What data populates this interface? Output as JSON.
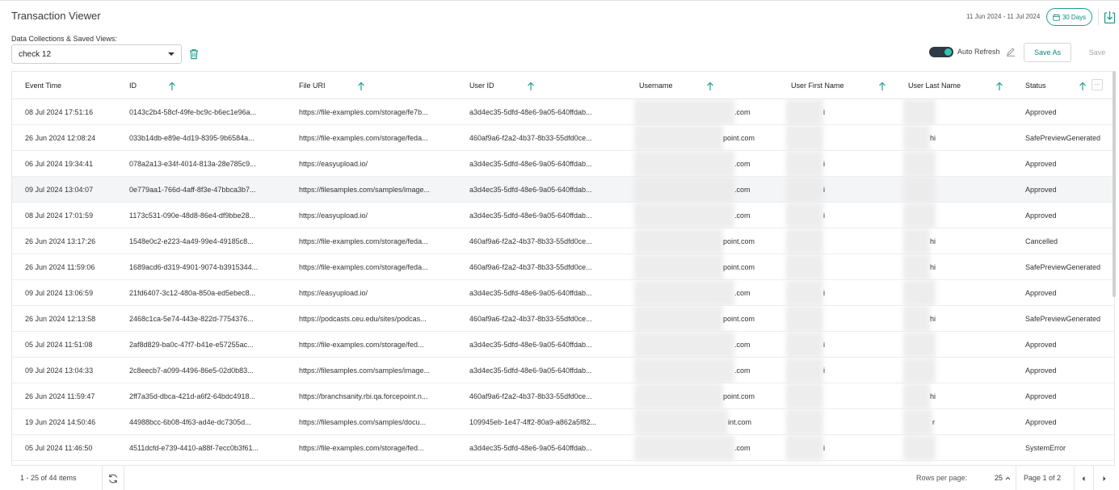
{
  "header": {
    "title": "Transaction Viewer",
    "date_range": "11 Jun 2024 - 11 Jul 2024",
    "days_label": "30 Days",
    "accent_color": "#1aa08e"
  },
  "collections": {
    "label": "Data Collections & Saved Views:",
    "selected": "check 12"
  },
  "toolbar": {
    "auto_refresh_label": "Auto Refresh",
    "auto_refresh_on": true,
    "save_as_label": "Save As",
    "save_label": "Save"
  },
  "table": {
    "columns": [
      "Event Time",
      "ID",
      "File URI",
      "User ID",
      "Username",
      "User First Name",
      "User Last Name",
      "Status"
    ],
    "rows": [
      {
        "time": "08 Jul 2024 17:51:16",
        "id": "0143c2b4-58cf-49fe-bc9c-b6ec1e96a...",
        "uri": "https://file-examples.com/storage/fe7b...",
        "user_id": "a3d4ec35-5dfd-48e6-9a05-640ffdab...",
        "username": ".com",
        "first": "i",
        "last": "",
        "status": "Approved"
      },
      {
        "time": "26 Jun 2024 12:08:24",
        "id": "033b14db-e89e-4d19-8395-9b6584a...",
        "uri": "https://file-examples.com/storage/feda...",
        "user_id": "460af9a6-f2a2-4b37-8b33-55dfd0ce...",
        "username": "point.com",
        "first": "",
        "last": "hi",
        "status": "SafePreviewGenerated"
      },
      {
        "time": "06 Jul 2024 19:34:41",
        "id": "078a2a13-e34f-4014-813a-28e785c9...",
        "uri": "https://easyupload.io/",
        "user_id": "a3d4ec35-5dfd-48e6-9a05-640ffdab...",
        "username": ".com",
        "first": "i",
        "last": "",
        "status": "Approved"
      },
      {
        "time": "09 Jul 2024 13:04:07",
        "id": "0e779aa1-766d-4aff-8f3e-47bbca3b7...",
        "uri": "https://filesamples.com/samples/image...",
        "user_id": "a3d4ec35-5dfd-48e6-9a05-640ffdab...",
        "username": ".com",
        "first": "i",
        "last": "",
        "status": "Approved"
      },
      {
        "time": "08 Jul 2024 17:01:59",
        "id": "1173c531-090e-48d8-86e4-df9bbe28...",
        "uri": "https://easyupload.io/",
        "user_id": "a3d4ec35-5dfd-48e6-9a05-640ffdab...",
        "username": ".com",
        "first": "i",
        "last": "",
        "status": "Approved"
      },
      {
        "time": "26 Jun 2024 13:17:26",
        "id": "1548e0c2-e223-4a49-99e4-49185c8...",
        "uri": "https://file-examples.com/storage/feda...",
        "user_id": "460af9a6-f2a2-4b37-8b33-55dfd0ce...",
        "username": "point.com",
        "first": "",
        "last": "hi",
        "status": "Cancelled"
      },
      {
        "time": "26 Jun 2024 11:59:06",
        "id": "1689acd6-d319-4901-9074-b3915344...",
        "uri": "https://file-examples.com/storage/feda...",
        "user_id": "460af9a6-f2a2-4b37-8b33-55dfd0ce...",
        "username": "point.com",
        "first": "",
        "last": "hi",
        "status": "SafePreviewGenerated"
      },
      {
        "time": "09 Jul 2024 13:06:59",
        "id": "21fd6407-3c12-480a-850a-ed5ebec8...",
        "uri": "https://easyupload.io/",
        "user_id": "a3d4ec35-5dfd-48e6-9a05-640ffdab...",
        "username": ".com",
        "first": "i",
        "last": "",
        "status": "Approved"
      },
      {
        "time": "26 Jun 2024 12:13:58",
        "id": "2468c1ca-5e74-443e-822d-7754376...",
        "uri": "https://podcasts.ceu.edu/sites/podcas...",
        "user_id": "460af9a6-f2a2-4b37-8b33-55dfd0ce...",
        "username": "point.com",
        "first": "",
        "last": "hi",
        "status": "SafePreviewGenerated"
      },
      {
        "time": "05 Jul 2024 11:51:08",
        "id": "2af8d829-ba0c-47f7-b41e-e57255ac...",
        "uri": "https://file-examples.com/storage/fed...",
        "user_id": "a3d4ec35-5dfd-48e6-9a05-640ffdab...",
        "username": ".com",
        "first": "i",
        "last": "",
        "status": "Approved"
      },
      {
        "time": "09 Jul 2024 13:04:33",
        "id": "2c8eecb7-a099-4496-86e5-02d0b83...",
        "uri": "https://filesamples.com/samples/image...",
        "user_id": "a3d4ec35-5dfd-48e6-9a05-640ffdab...",
        "username": ".com",
        "first": "i",
        "last": "",
        "status": "Approved"
      },
      {
        "time": "26 Jun 2024 11:59:47",
        "id": "2ff7a35d-dbca-421d-a6f2-64bdc4918...",
        "uri": "https://branchsanity.rbi.qa.forcepoint.n...",
        "user_id": "460af9a6-f2a2-4b37-8b33-55dfd0ce...",
        "username": "point.com",
        "first": "",
        "last": "hi",
        "status": "Approved"
      },
      {
        "time": "19 Jun 2024 14:50:46",
        "id": "44988bcc-6b08-4f63-ad4e-dc7305d...",
        "uri": "https://filesamples.com/samples/docu...",
        "user_id": "109945eb-1e47-4ff2-80a9-a862a5f82...",
        "username": "int.com",
        "first": "",
        "last": "r",
        "status": "Approved"
      },
      {
        "time": "05 Jul 2024 11:46:50",
        "id": "4511dcfd-e739-4410-a88f-7ecc0b3f61...",
        "uri": "https://file-examples.com/storage/fed...",
        "user_id": "a3d4ec35-5dfd-48e6-9a05-640ffdab...",
        "username": ".com",
        "first": "i",
        "last": "",
        "status": "SystemError"
      }
    ]
  },
  "footer": {
    "items_label": "1 - 25 of 44 items",
    "rows_per_page_label": "Rows per page:",
    "rows_per_page_value": "25",
    "page_label": "Page 1 of 2"
  },
  "icons": {
    "calendar": "calendar-icon",
    "export": "export-icon",
    "trash": "trash-icon",
    "edit": "pencil-icon",
    "sort": "arrow-up-icon",
    "refresh": "refresh-icon",
    "prev": "chevron-left-icon",
    "next": "chevron-right-icon"
  }
}
